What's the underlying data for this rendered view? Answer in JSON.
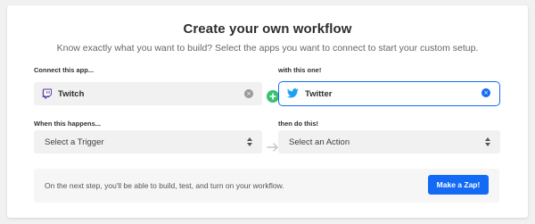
{
  "header": {
    "title": "Create your own workflow",
    "subtitle": "Know exactly what you want to build? Select the apps you want to connect to start your custom setup."
  },
  "trigger_app": {
    "label": "Connect this app...",
    "value": "Twitch",
    "icon": "twitch-icon",
    "brand_color": "#6441a5"
  },
  "action_app": {
    "label": "with this one!",
    "value": "Twitter",
    "icon": "twitter-icon",
    "brand_color": "#1da1f2"
  },
  "trigger_event": {
    "label": "When this happens...",
    "value": "Select a Trigger"
  },
  "action_event": {
    "label": "then do this!",
    "value": "Select an Action"
  },
  "footer": {
    "text": "On the next step, you'll be able to build, test, and turn on your workflow.",
    "button_label": "Make a Zap!"
  },
  "colors": {
    "accent": "#136bf5",
    "connector": "#38c172"
  }
}
